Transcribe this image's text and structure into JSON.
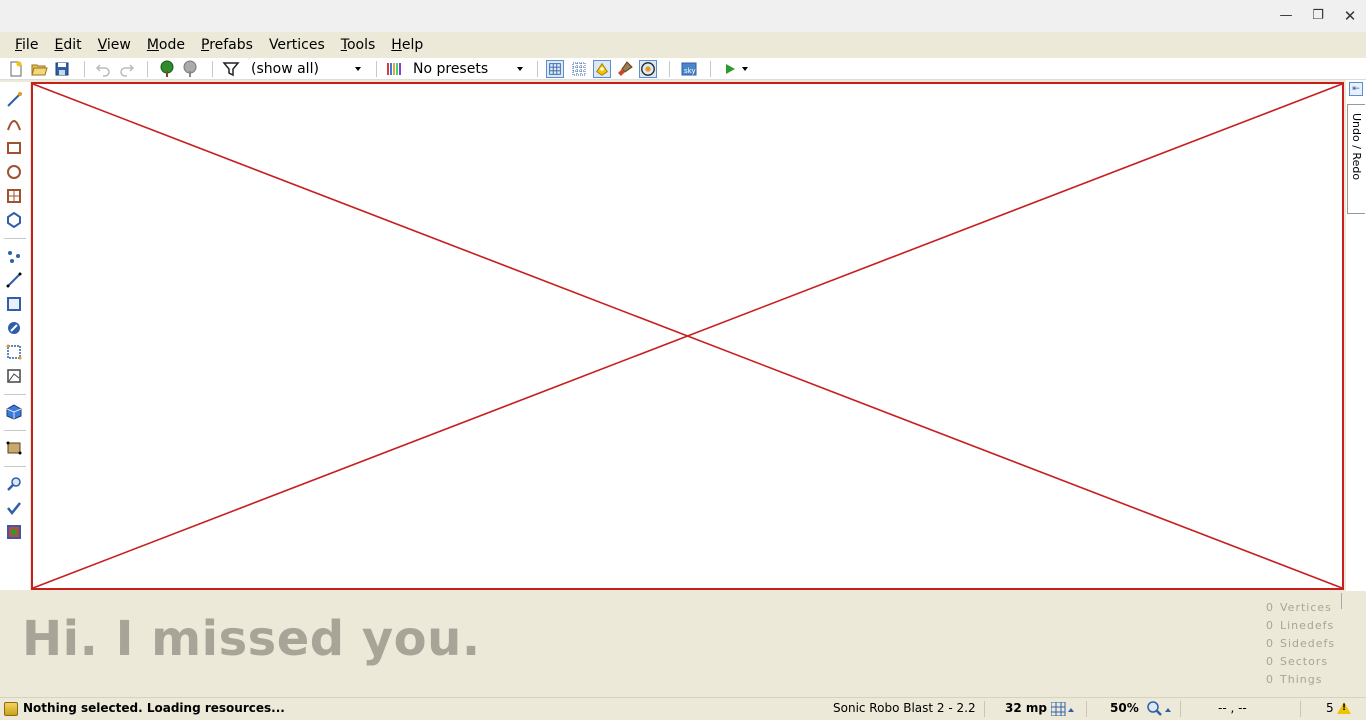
{
  "window": {
    "minimize_glyph": "—",
    "maximize_glyph": "❐",
    "close_glyph": "✕"
  },
  "menu": {
    "items": [
      {
        "label": "File",
        "underline": "F",
        "rest": "ile"
      },
      {
        "label": "Edit",
        "underline": "E",
        "rest": "dit"
      },
      {
        "label": "View",
        "underline": "V",
        "rest": "iew"
      },
      {
        "label": "Mode",
        "underline": "M",
        "rest": "ode"
      },
      {
        "label": "Prefabs",
        "underline": "P",
        "rest": "refabs"
      },
      {
        "label": "Vertices",
        "underline": "",
        "rest": "Vertices"
      },
      {
        "label": "Tools",
        "underline": "T",
        "rest": "ools"
      },
      {
        "label": "Help",
        "underline": "H",
        "rest": "elp"
      }
    ]
  },
  "toolbar": {
    "filter_value": "(show all)",
    "presets_value": "No presets"
  },
  "dock": {
    "tab_label": "Undo / Redo",
    "pin_glyph": "⇤"
  },
  "info": {
    "greeting": "Hi. I missed you.",
    "stats": [
      {
        "count": "0",
        "label": "Vertices"
      },
      {
        "count": "0",
        "label": "Linedefs"
      },
      {
        "count": "0",
        "label": "Sidedefs"
      },
      {
        "count": "0",
        "label": "Sectors"
      },
      {
        "count": "0",
        "label": "Things"
      }
    ]
  },
  "status": {
    "message": "Nothing selected. Loading resources...",
    "game": "Sonic Robo Blast 2 - 2.2",
    "grid": "32 mp",
    "zoom": "50%",
    "coords": "-- , --",
    "warnings": "5"
  },
  "colors": {
    "canvas_border": "#c81e1e",
    "panel_bg": "#ece9d8",
    "greeting_text": "#a8a497",
    "active_button": "#5b8fd2"
  }
}
